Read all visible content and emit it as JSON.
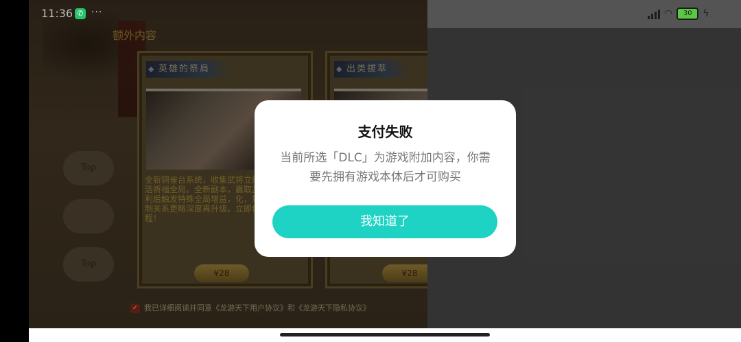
{
  "status_bar": {
    "time": "11:36",
    "call_icon": "phone-icon",
    "more_dots": "···",
    "battery": "30"
  },
  "game": {
    "section_title": "额外内容",
    "cards": [
      {
        "title": "英雄的祭肩",
        "description": "全新铜雀台系统，收集武将立绘与羁绊，激活祈福全局。全新副本，赢取武将碎片与胜利后触发特殊全局增益，化，属性提升，克制关系更略深度再升级。立即体验，雄征程！",
        "price": "¥28"
      },
      {
        "title": "出类拔萃",
        "description": "",
        "price": "¥28"
      }
    ],
    "agreement": "我已详细阅读并同意《龙游天下用户协议》和《龙游天下隐私协议》",
    "sidebar_labels": [
      "Top",
      "",
      "Top"
    ]
  },
  "dialog": {
    "title": "支付失败",
    "message_line1": "当前所选「DLC」为游戏附加内容，你需",
    "message_line2": "要先拥有游戏本体后才可购买",
    "button": "我知道了"
  },
  "colors": {
    "accent_button": "#1ed3c4",
    "call_badge": "#27c36b",
    "battery": "#59c943"
  }
}
